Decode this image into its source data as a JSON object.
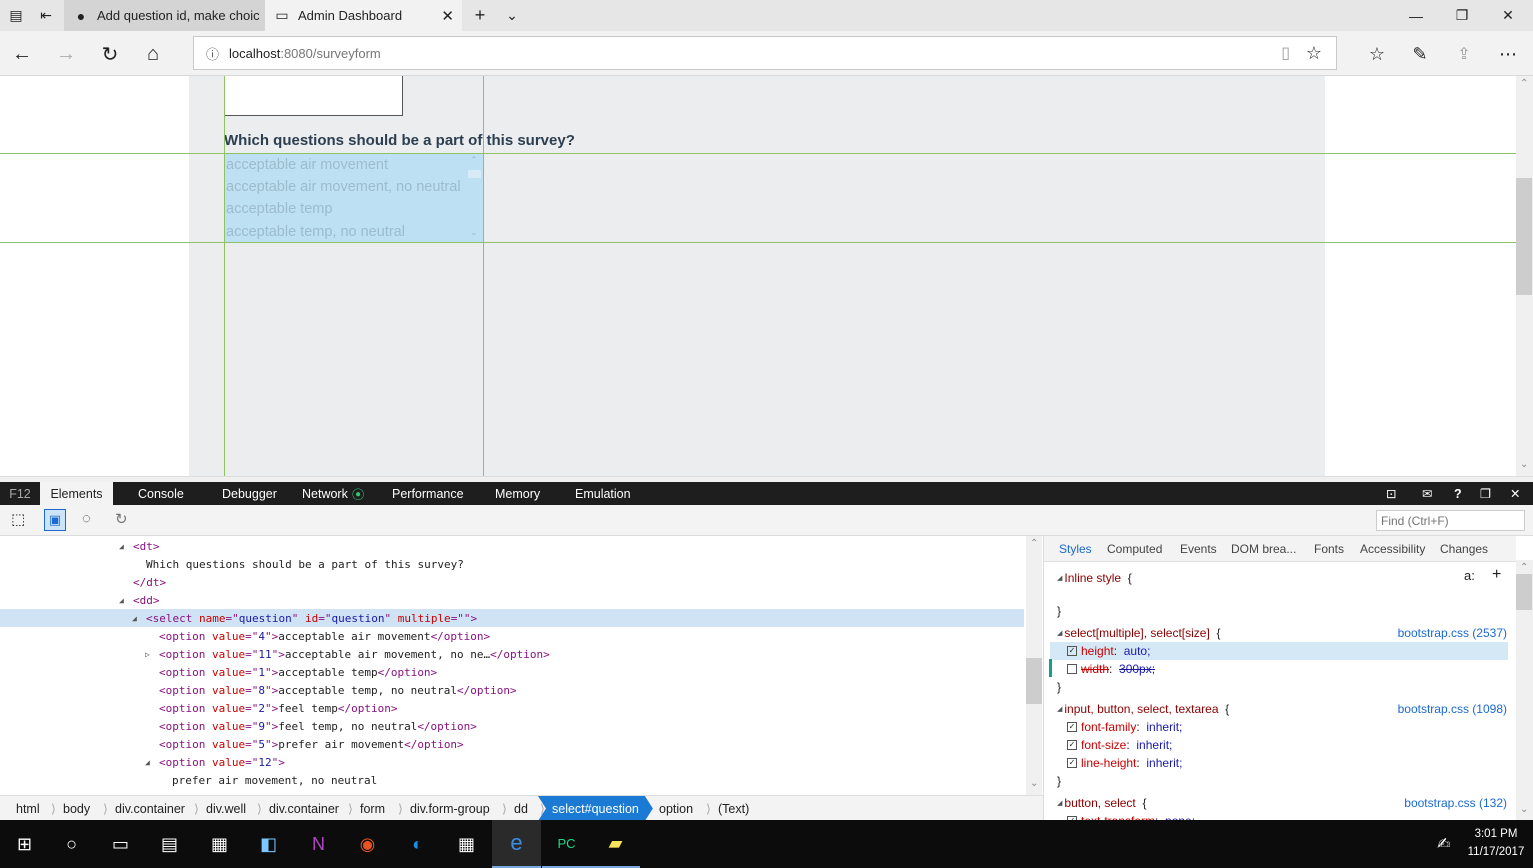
{
  "tabs": [
    {
      "label": "Add question id, make choic",
      "icon": "github-icon",
      "active": false
    },
    {
      "label": "Admin Dashboard",
      "icon": "page-icon",
      "active": true
    }
  ],
  "url": {
    "host": "localhost",
    "rest": ":8080/surveyform"
  },
  "page": {
    "question_label": "Which questions should be a part of this survey?",
    "options": [
      "acceptable air movement",
      "acceptable air movement, no neutral",
      "acceptable temp",
      "acceptable temp, no neutral"
    ]
  },
  "devtools": {
    "f12": "F12",
    "tabs": [
      "Elements",
      "Console",
      "Debugger",
      "Network",
      "Performance",
      "Memory",
      "Emulation"
    ],
    "find_placeholder": "Find (Ctrl+F)",
    "dom": [
      {
        "indent": 0,
        "toggle": "◢",
        "parts": [
          [
            "tg",
            "<dt>"
          ]
        ]
      },
      {
        "indent": 1,
        "toggle": "",
        "parts": [
          [
            "tx",
            "Which questions should be a part of this survey?"
          ]
        ]
      },
      {
        "indent": 0,
        "toggle": "",
        "parts": [
          [
            "tg",
            "</dt>"
          ]
        ]
      },
      {
        "indent": 0,
        "toggle": "◢",
        "parts": [
          [
            "tg",
            "<dd>"
          ]
        ]
      },
      {
        "indent": 1,
        "toggle": "◢",
        "selected": true,
        "parts": [
          [
            "tg",
            "<select "
          ],
          [
            "an",
            "name"
          ],
          [
            "tg",
            "=\""
          ],
          [
            "av",
            "question"
          ],
          [
            "tg",
            "\" "
          ],
          [
            "an",
            "id"
          ],
          [
            "tg",
            "=\""
          ],
          [
            "av",
            "question"
          ],
          [
            "tg",
            "\" "
          ],
          [
            "an",
            "multiple"
          ],
          [
            "tg",
            "=\"\">"
          ]
        ]
      },
      {
        "indent": 2,
        "toggle": "",
        "parts": [
          [
            "tg",
            "<option "
          ],
          [
            "an",
            "value"
          ],
          [
            "tg",
            "=\""
          ],
          [
            "av",
            "4"
          ],
          [
            "tg",
            "\">"
          ],
          [
            "tx",
            "acceptable air movement"
          ],
          [
            "tg",
            "</option>"
          ]
        ]
      },
      {
        "indent": 2,
        "toggle": "▷",
        "parts": [
          [
            "tg",
            "<option "
          ],
          [
            "an",
            "value"
          ],
          [
            "tg",
            "=\""
          ],
          [
            "av",
            "11"
          ],
          [
            "tg",
            "\">"
          ],
          [
            "tx",
            "acceptable air movement, no ne…"
          ],
          [
            "tg",
            "</option>"
          ]
        ]
      },
      {
        "indent": 2,
        "toggle": "",
        "parts": [
          [
            "tg",
            "<option "
          ],
          [
            "an",
            "value"
          ],
          [
            "tg",
            "=\""
          ],
          [
            "av",
            "1"
          ],
          [
            "tg",
            "\">"
          ],
          [
            "tx",
            "acceptable temp"
          ],
          [
            "tg",
            "</option>"
          ]
        ]
      },
      {
        "indent": 2,
        "toggle": "",
        "parts": [
          [
            "tg",
            "<option "
          ],
          [
            "an",
            "value"
          ],
          [
            "tg",
            "=\""
          ],
          [
            "av",
            "8"
          ],
          [
            "tg",
            "\">"
          ],
          [
            "tx",
            "acceptable temp, no neutral"
          ],
          [
            "tg",
            "</option>"
          ]
        ]
      },
      {
        "indent": 2,
        "toggle": "",
        "parts": [
          [
            "tg",
            "<option "
          ],
          [
            "an",
            "value"
          ],
          [
            "tg",
            "=\""
          ],
          [
            "av",
            "2"
          ],
          [
            "tg",
            "\">"
          ],
          [
            "tx",
            "feel temp"
          ],
          [
            "tg",
            "</option>"
          ]
        ]
      },
      {
        "indent": 2,
        "toggle": "",
        "parts": [
          [
            "tg",
            "<option "
          ],
          [
            "an",
            "value"
          ],
          [
            "tg",
            "=\""
          ],
          [
            "av",
            "9"
          ],
          [
            "tg",
            "\">"
          ],
          [
            "tx",
            "feel temp, no neutral"
          ],
          [
            "tg",
            "</option>"
          ]
        ]
      },
      {
        "indent": 2,
        "toggle": "",
        "parts": [
          [
            "tg",
            "<option "
          ],
          [
            "an",
            "value"
          ],
          [
            "tg",
            "=\""
          ],
          [
            "av",
            "5"
          ],
          [
            "tg",
            "\">"
          ],
          [
            "tx",
            "prefer air movement"
          ],
          [
            "tg",
            "</option>"
          ]
        ]
      },
      {
        "indent": 2,
        "toggle": "◢",
        "parts": [
          [
            "tg",
            "<option "
          ],
          [
            "an",
            "value"
          ],
          [
            "tg",
            "=\""
          ],
          [
            "av",
            "12"
          ],
          [
            "tg",
            "\">"
          ]
        ]
      },
      {
        "indent": 3,
        "toggle": "",
        "parts": [
          [
            "tx",
            "prefer air movement, no neutral"
          ]
        ]
      }
    ],
    "breadcrumbs": [
      "html",
      "body",
      "div.container",
      "div.well",
      "div.container",
      "form",
      "div.form-group",
      "dd",
      "select#question",
      "option",
      "(Text)"
    ],
    "active_crumb": "select#question",
    "style_tabs": [
      "Styles",
      "Computed",
      "Events",
      "DOM brea...",
      "Fonts",
      "Accessibility",
      "Changes"
    ],
    "rules": [
      {
        "selector": "Inline style",
        "source": "",
        "props": []
      },
      {
        "selector": "select[multiple], select[size]",
        "source": "bootstrap.css (2537)",
        "props": [
          {
            "name": "height",
            "value": "auto;",
            "checked": true,
            "struck": false
          },
          {
            "name": "width",
            "value": "300px;",
            "checked": false,
            "struck": true
          }
        ]
      },
      {
        "selector": "input, button, select, textarea",
        "source": "bootstrap.css (1098)",
        "props": [
          {
            "name": "font-family",
            "value": "inherit;",
            "checked": true,
            "struck": false
          },
          {
            "name": "font-size",
            "value": "inherit;",
            "checked": true,
            "struck": false
          },
          {
            "name": "line-height",
            "value": "inherit;",
            "checked": true,
            "struck": false
          }
        ]
      },
      {
        "selector": "button, select",
        "source": "bootstrap.css (132)",
        "props": [
          {
            "name": "text-transform",
            "value": "none;",
            "checked": true,
            "struck": false
          }
        ]
      }
    ]
  },
  "clock": {
    "time": "3:01 PM",
    "date": "11/17/2017"
  }
}
